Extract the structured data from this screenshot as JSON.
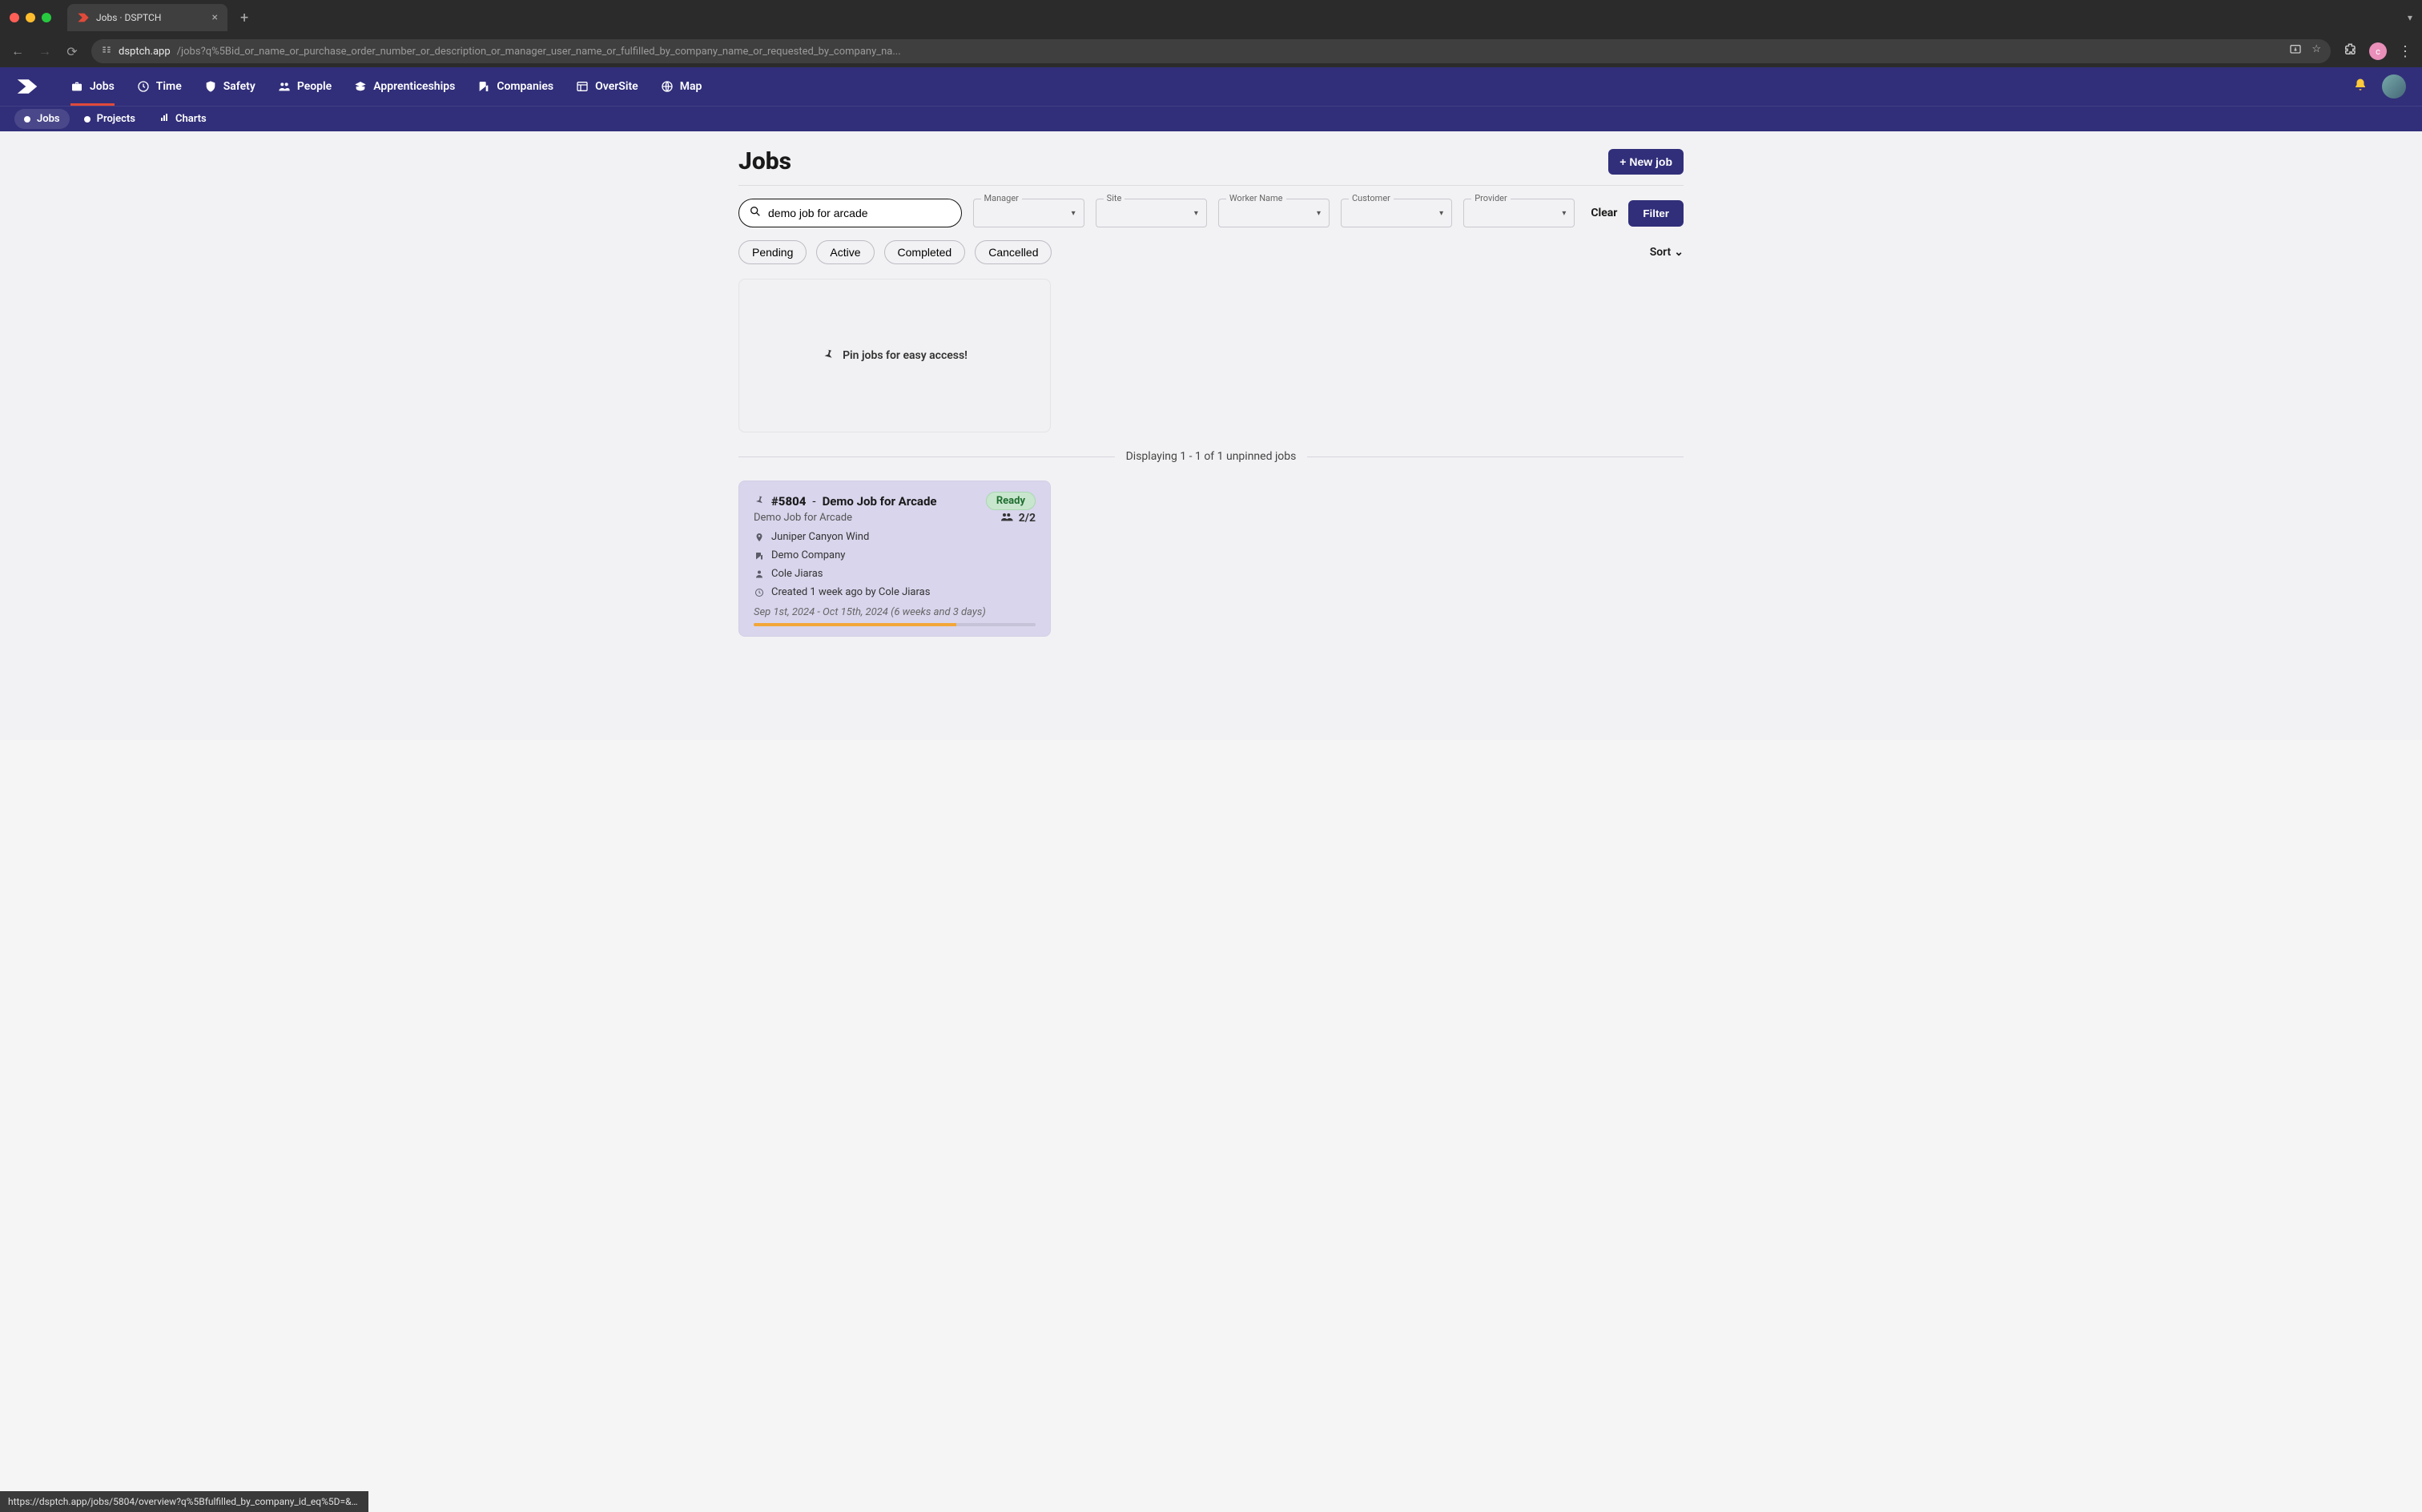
{
  "browser": {
    "tab_title": "Jobs · DSPTCH",
    "url_domain": "dsptch.app",
    "url_path": "/jobs?q%5Bid_or_name_or_purchase_order_number_or_description_or_manager_user_name_or_fulfilled_by_company_name_or_requested_by_company_na...",
    "profile_letter": "c"
  },
  "nav": {
    "items": [
      {
        "label": "Jobs"
      },
      {
        "label": "Time"
      },
      {
        "label": "Safety"
      },
      {
        "label": "People"
      },
      {
        "label": "Apprenticeships"
      },
      {
        "label": "Companies"
      },
      {
        "label": "OverSite"
      },
      {
        "label": "Map"
      }
    ]
  },
  "subnav": {
    "items": [
      {
        "label": "Jobs"
      },
      {
        "label": "Projects"
      },
      {
        "label": "Charts"
      }
    ]
  },
  "page": {
    "title": "Jobs",
    "new_job_label": "+ New job",
    "search_value": "demo job for arcade",
    "filters": {
      "manager": "Manager",
      "site": "Site",
      "worker_name": "Worker Name",
      "customer": "Customer",
      "provider": "Provider"
    },
    "clear_label": "Clear",
    "filter_label": "Filter",
    "chips": [
      "Pending",
      "Active",
      "Completed",
      "Cancelled"
    ],
    "sort_label": "Sort",
    "pin_placeholder": "Pin jobs for easy access!",
    "results_text": "Displaying 1 - 1 of 1 unpinned jobs"
  },
  "job": {
    "id": "#5804",
    "name_sep": " - ",
    "name": "Demo Job for Arcade",
    "status": "Ready",
    "subtitle": "Demo Job for Arcade",
    "workers": "2/2",
    "site": "Juniper Canyon Wind",
    "company": "Demo Company",
    "manager": "Cole Jiaras",
    "created": "Created 1 week ago by Cole Jiaras",
    "dates": "Sep 1st, 2024 - Oct 15th, 2024 (6 weeks and 3 days)",
    "progress_pct": 72
  },
  "status_url": "https://dsptch.app/jobs/5804/overview?q%5Bfulfilled_by_company_id_eq%5D=&q%..."
}
